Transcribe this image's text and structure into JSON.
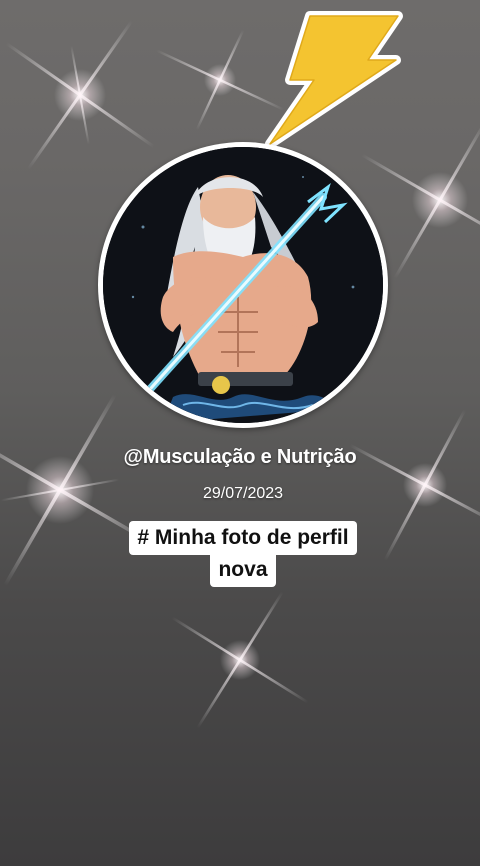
{
  "post": {
    "username": "@Musculação e Nutrição",
    "date": "29/07/2023",
    "caption_line1": "# Minha foto de perfil",
    "caption_line2": "nova"
  },
  "stickers": {
    "bolt": "lightning-bolt-icon"
  },
  "colors": {
    "bolt_yellow": "#f4c430",
    "caption_bg": "#ffffff",
    "text_white": "#ffffff"
  }
}
